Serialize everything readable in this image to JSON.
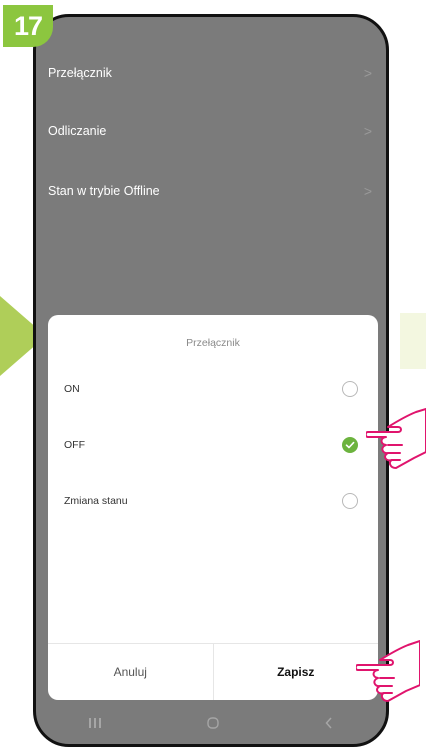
{
  "step": {
    "number": "17"
  },
  "menu": {
    "items": [
      {
        "label": "Przełącznik",
        "chevron": ">"
      },
      {
        "label": "Odliczanie",
        "chevron": ">"
      },
      {
        "label": "Stan w trybie Offline",
        "chevron": ">"
      }
    ]
  },
  "dialog": {
    "title": "Przełącznik",
    "options": [
      {
        "label": "ON",
        "selected": false
      },
      {
        "label": "OFF",
        "selected": true
      },
      {
        "label": "Zmiana stanu",
        "selected": false
      }
    ],
    "cancel_label": "Anuluj",
    "save_label": "Zapisz"
  },
  "navbar": {
    "recents_icon": "recents-icon",
    "home_icon": "home-icon",
    "back_icon": "back-icon"
  },
  "colors": {
    "accent_green": "#8cc63f",
    "check_green": "#6cb33e",
    "hand_magenta": "#e0146d",
    "overlay_gray": "#7b7b7b"
  }
}
